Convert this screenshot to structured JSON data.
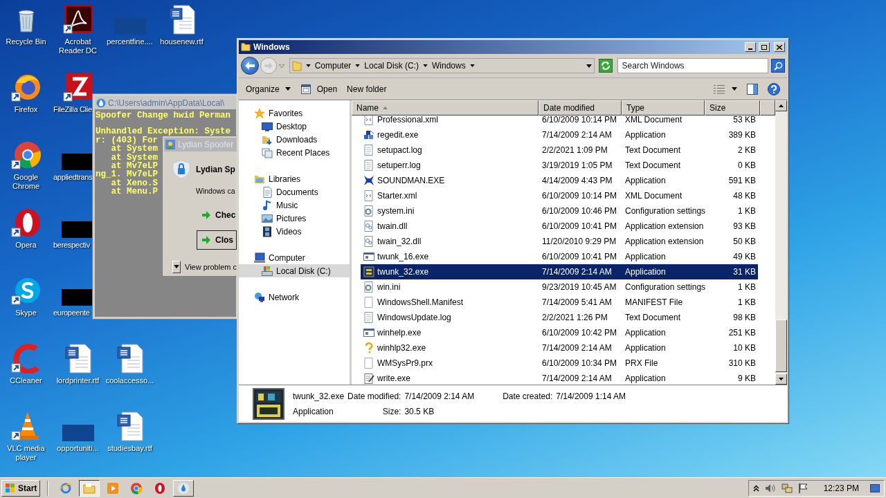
{
  "desktop_rows": [
    [
      {
        "label": "Recycle Bin",
        "kind": "recycle",
        "shortcut": false
      },
      {
        "label": "Acrobat Reader DC",
        "kind": "acrobat",
        "shortcut": true
      },
      {
        "label": "percentfine....",
        "kind": "blank",
        "shortcut": false
      },
      {
        "label": "housenew.rtf",
        "kind": "word",
        "shortcut": false
      }
    ],
    [
      {
        "label": "Firefox",
        "kind": "firefox",
        "shortcut": true
      },
      {
        "label": "FileZilla Clie",
        "kind": "filezilla",
        "shortcut": true
      }
    ],
    [
      {
        "label": "Google Chrome",
        "kind": "chrome",
        "shortcut": true
      },
      {
        "label": "appliedtrans",
        "kind": "redacted",
        "shortcut": false
      }
    ],
    [
      {
        "label": "Opera",
        "kind": "opera",
        "shortcut": true
      },
      {
        "label": "berespectiv",
        "kind": "redacted",
        "shortcut": false
      }
    ],
    [
      {
        "label": "Skype",
        "kind": "skype",
        "shortcut": true
      },
      {
        "label": "europeente",
        "kind": "redacted",
        "shortcut": false
      }
    ],
    [
      {
        "label": "CCleaner",
        "kind": "ccleaner",
        "shortcut": true
      },
      {
        "label": "lordprinter.rtf",
        "kind": "word",
        "shortcut": false
      },
      {
        "label": "coolaccesso...",
        "kind": "word",
        "shortcut": false
      }
    ],
    [
      {
        "label": "VLC media player",
        "kind": "vlc",
        "shortcut": true
      },
      {
        "label": "opportuniti...",
        "kind": "blank",
        "shortcut": false
      },
      {
        "label": "studiesbay.rtf",
        "kind": "word",
        "shortcut": false
      }
    ]
  ],
  "console_window": {
    "title": "C:\\Users\\admin\\AppData\\Local\\",
    "blocks": [
      [
        "Spoofer Change hwid Perman"
      ],
      [
        "Unhandled Exception: Syste",
        "r: (403) For",
        "   at System",
        "   at System",
        "   at Mv7eLP",
        "ng_1. Mv7eLP",
        "   at Xeno.S",
        "   at Menu.P"
      ]
    ]
  },
  "error_dialog": {
    "title": "Lydian Spoofer",
    "heading": "Lydian Sp",
    "message": "Windows ca",
    "options": [
      {
        "label": "Chec",
        "focused": false
      },
      {
        "label": "Clos",
        "focused": true
      }
    ],
    "details_toggle": "View problem c"
  },
  "explorer": {
    "title": "Windows",
    "breadcrumb": [
      "Computer",
      "Local Disk (C:)",
      "Windows"
    ],
    "search": {
      "placeholder": "Search Windows"
    },
    "toolbar": [
      {
        "label": "Organize",
        "kind": "menu"
      },
      {
        "label": "Open",
        "kind": "open"
      },
      {
        "label": "New folder",
        "kind": "plain"
      }
    ],
    "nav": [
      {
        "label": "Favorites",
        "kind": "star",
        "selected": false,
        "children": [
          {
            "label": "Desktop",
            "kind": "monitor",
            "selected": false
          },
          {
            "label": "Downloads",
            "kind": "download",
            "selected": false
          },
          {
            "label": "Recent Places",
            "kind": "recent",
            "selected": false
          }
        ]
      },
      {
        "label": "Libraries",
        "kind": "library",
        "selected": false,
        "children": [
          {
            "label": "Documents",
            "kind": "document",
            "selected": false
          },
          {
            "label": "Music",
            "kind": "note",
            "selected": false
          },
          {
            "label": "Pictures",
            "kind": "picture",
            "selected": false
          },
          {
            "label": "Videos",
            "kind": "film",
            "selected": false
          }
        ]
      },
      {
        "label": "Computer",
        "kind": "computer",
        "selected": false,
        "children": [
          {
            "label": "Local Disk (C:)",
            "kind": "drive",
            "selected": true
          }
        ]
      },
      {
        "label": "Network",
        "kind": "network",
        "selected": false
      }
    ],
    "columns": [
      {
        "label": "Name",
        "sorted": true
      },
      {
        "label": "Date modified",
        "sorted": false
      },
      {
        "label": "Type",
        "sorted": false
      },
      {
        "label": "Size",
        "sorted": false
      }
    ],
    "files": [
      {
        "name": "Professional.xml",
        "date": "6/10/2009 10:14 PM",
        "type": "XML Document",
        "size": "53 KB",
        "kind": "xml",
        "selected": false
      },
      {
        "name": "regedit.exe",
        "date": "7/14/2009 2:14 AM",
        "type": "Application",
        "size": "389 KB",
        "kind": "registry",
        "selected": false
      },
      {
        "name": "setupact.log",
        "date": "2/2/2021 1:09 PM",
        "type": "Text Document",
        "size": "2 KB",
        "kind": "text",
        "selected": false
      },
      {
        "name": "setuperr.log",
        "date": "3/19/2019 1:05 PM",
        "type": "Text Document",
        "size": "0 KB",
        "kind": "text",
        "selected": false
      },
      {
        "name": "SOUNDMAN.EXE",
        "date": "4/14/2009 4:43 PM",
        "type": "Application",
        "size": "591 KB",
        "kind": "speaker",
        "selected": false
      },
      {
        "name": "Starter.xml",
        "date": "6/10/2009 10:14 PM",
        "type": "XML Document",
        "size": "48 KB",
        "kind": "xml",
        "selected": false
      },
      {
        "name": "system.ini",
        "date": "6/10/2009 10:46 PM",
        "type": "Configuration settings",
        "size": "1 KB",
        "kind": "settings",
        "selected": false
      },
      {
        "name": "twain.dll",
        "date": "6/10/2009 10:41 PM",
        "type": "Application extension",
        "size": "93 KB",
        "kind": "extension",
        "selected": false
      },
      {
        "name": "twain_32.dll",
        "date": "11/20/2010 9:29 PM",
        "type": "Application extension",
        "size": "50 KB",
        "kind": "extension",
        "selected": false
      },
      {
        "name": "twunk_16.exe",
        "date": "6/10/2009 10:41 PM",
        "type": "Application",
        "size": "49 KB",
        "kind": "program",
        "selected": false
      },
      {
        "name": "twunk_32.exe",
        "date": "7/14/2009 2:14 AM",
        "type": "Application",
        "size": "31 KB",
        "kind": "twain",
        "selected": true
      },
      {
        "name": "win.ini",
        "date": "9/23/2019 10:45 AM",
        "type": "Configuration settings",
        "size": "1 KB",
        "kind": "settings",
        "selected": false
      },
      {
        "name": "WindowsShell.Manifest",
        "date": "7/14/2009 5:41 AM",
        "type": "MANIFEST File",
        "size": "1 KB",
        "kind": "blank",
        "selected": false
      },
      {
        "name": "WindowsUpdate.log",
        "date": "2/2/2021 1:26 PM",
        "type": "Text Document",
        "size": "98 KB",
        "kind": "text",
        "selected": false
      },
      {
        "name": "winhelp.exe",
        "date": "6/10/2009 10:42 PM",
        "type": "Application",
        "size": "251 KB",
        "kind": "program",
        "selected": false
      },
      {
        "name": "winhlp32.exe",
        "date": "7/14/2009 2:14 AM",
        "type": "Application",
        "size": "10 KB",
        "kind": "help",
        "selected": false
      },
      {
        "name": "WMSysPr9.prx",
        "date": "6/10/2009 10:34 PM",
        "type": "PRX File",
        "size": "310 KB",
        "kind": "blank",
        "selected": false
      },
      {
        "name": "write.exe",
        "date": "7/14/2009 2:14 AM",
        "type": "Application",
        "size": "9 KB",
        "kind": "notepad",
        "selected": false
      }
    ],
    "details": {
      "name": "twunk_32.exe",
      "type": "Application",
      "fields": [
        {
          "label": "Date modified:",
          "value": "7/14/2009 2:14 AM"
        },
        {
          "label": "Date created:",
          "value": "7/14/2009 1:14 AM"
        },
        {
          "label": "Size:",
          "value": "30.5 KB"
        }
      ]
    }
  },
  "taskbar": {
    "start": "Start",
    "apps": [
      {
        "kind": "ie",
        "open": false,
        "selected": false
      },
      {
        "kind": "folder",
        "open": true,
        "selected": true
      },
      {
        "kind": "media",
        "open": false,
        "selected": false
      },
      {
        "kind": "chrome",
        "open": false,
        "selected": false
      },
      {
        "kind": "opera",
        "open": false,
        "selected": false
      },
      {
        "kind": "droplet",
        "open": true,
        "selected": false
      }
    ],
    "clock": "12:23 PM"
  }
}
